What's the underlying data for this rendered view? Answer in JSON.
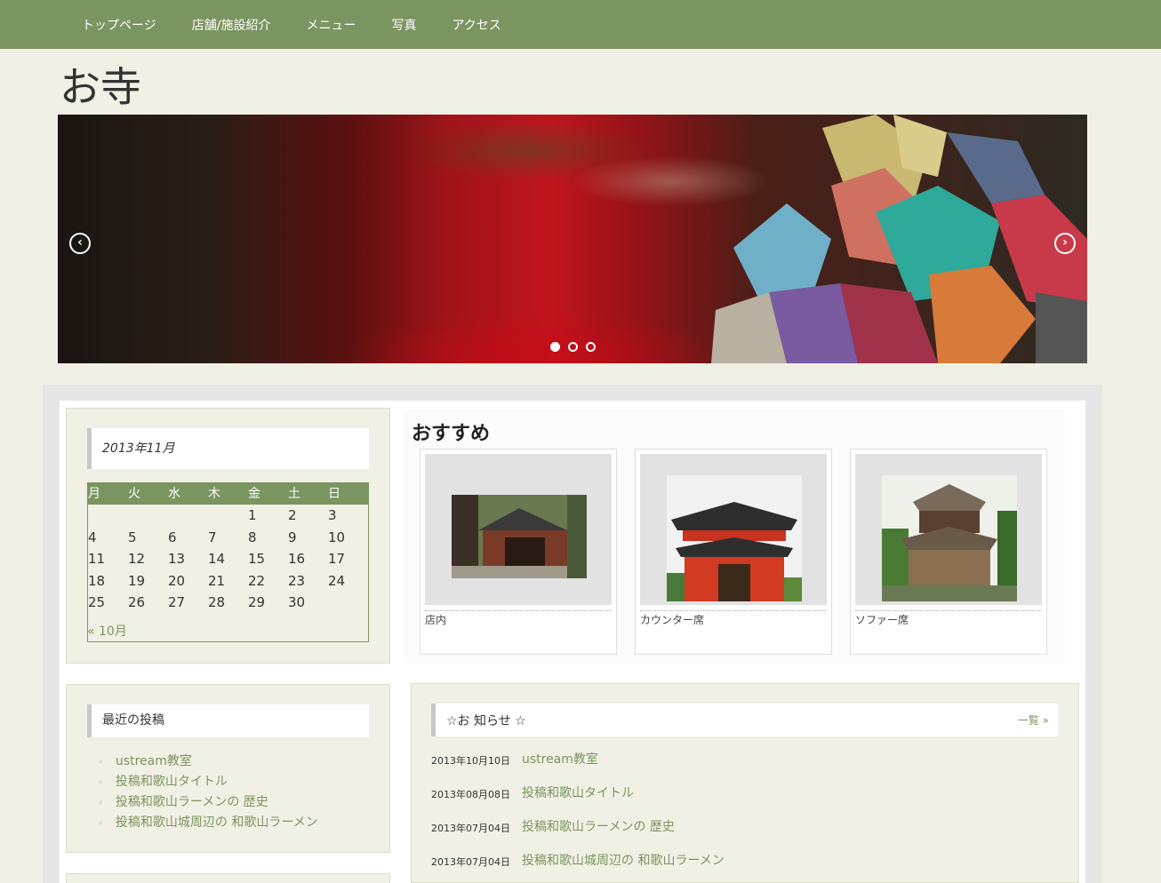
{
  "nav": {
    "items": [
      "トップページ",
      "店舗/施設紹介",
      "メニュー",
      "写真",
      "アクセス"
    ]
  },
  "site": {
    "title": "お寺"
  },
  "slider": {
    "prev": "‹",
    "next": "›",
    "slide_count": 3,
    "active_slide": 1
  },
  "calendar": {
    "caption": "2013年11月",
    "weekdays": [
      "月",
      "火",
      "水",
      "木",
      "金",
      "土",
      "日"
    ],
    "weeks": [
      [
        "",
        "",
        "",
        "",
        "1",
        "2",
        "3"
      ],
      [
        "4",
        "5",
        "6",
        "7",
        "8",
        "9",
        "10"
      ],
      [
        "11",
        "12",
        "13",
        "14",
        "15",
        "16",
        "17"
      ],
      [
        "18",
        "19",
        "20",
        "21",
        "22",
        "23",
        "24"
      ],
      [
        "25",
        "26",
        "27",
        "28",
        "29",
        "30",
        ""
      ]
    ],
    "prev_link": "« 10月"
  },
  "recent_posts": {
    "title": "最近の投稿",
    "items": [
      "ustream教室",
      "投稿和歌山タイトル",
      "投稿和歌山ラーメンの 歴史",
      "投稿和歌山城周辺の 和歌山ラーメン"
    ]
  },
  "recommended": {
    "title": "おすすめ",
    "cards": [
      {
        "caption": "店内"
      },
      {
        "caption": "カウンター席"
      },
      {
        "caption": "ソファー席"
      }
    ]
  },
  "news": {
    "title": "☆お 知らせ ☆",
    "more": "一覧 »",
    "items": [
      {
        "date": "2013年10月10日",
        "title": "ustream教室"
      },
      {
        "date": "2013年08月08日",
        "title": "投稿和歌山タイトル"
      },
      {
        "date": "2013年07月04日",
        "title": "投稿和歌山ラーメンの 歴史"
      },
      {
        "date": "2013年07月04日",
        "title": "投稿和歌山城周辺の 和歌山ラーメン"
      }
    ]
  },
  "colors": {
    "accent": "#7a9560",
    "background": "#f1f0e4"
  }
}
